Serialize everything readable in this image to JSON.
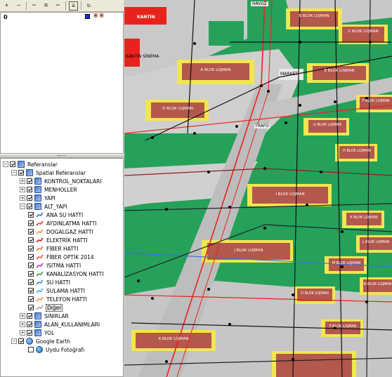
{
  "toolbar": {
    "icons": [
      "add-icon",
      "remove-icon",
      "expand-icon",
      "collapse-icon",
      "list-icon",
      "properties-icon",
      "refresh-icon"
    ]
  },
  "top_pane": {
    "value": "0",
    "colors": {
      "swatch": "#1c2fe8"
    }
  },
  "tree": {
    "root": "Referanslar",
    "spatial": "Spatial Referanslar",
    "kontrol": "KONTROL_NOKTALARI",
    "menholler": "MENHOLLER",
    "yapi": "YAPI",
    "alt_yapi": "ALT_YAPI",
    "layers": [
      {
        "label": "ANA SU HATTI",
        "color": "#3b6fe0"
      },
      {
        "label": "AYDINLATMA HATTI",
        "color": "#e03b3b"
      },
      {
        "label": "DOGALGAZ HATTI",
        "color": "#e0a03b"
      },
      {
        "label": "ELEKTRİK HATTI",
        "color": "#d02020"
      },
      {
        "label": "FİBER HATTI",
        "color": "#e07b3b"
      },
      {
        "label": "FİBER OPTİK 2014",
        "color": "#e05a3b"
      },
      {
        "label": "ISITMA HATTI",
        "color": "#b03bd0"
      },
      {
        "label": "KANALİZASYON HATTI",
        "color": "#5a8a3b"
      },
      {
        "label": "SU HATTI",
        "color": "#3b8ae0"
      },
      {
        "label": "SULAMA HATTI",
        "color": "#3bb0e0"
      },
      {
        "label": "TELEFON HATTI",
        "color": "#e09a3b"
      },
      {
        "label": "Diğer",
        "color": "#a0a0a0"
      }
    ],
    "sinirlar": "SINIRLAR",
    "alan": "ALAN_KULLANIMLARI",
    "yol": "YOL",
    "google": "Google Earth",
    "uydu": "Uydu Fotoğrafı"
  },
  "map": {
    "labels": {
      "kantin": "KANTİN",
      "havuz": "HAVUZ",
      "kantin_sinema": "KANTİN SİNEMA",
      "market": "MARKET",
      "trafo": "TRAFO",
      "blocks": [
        "A BLOK LOJMAN",
        "B BLOK LOJMAN",
        "C BLOK LOJMAN",
        "D BLOK LOJMAN",
        "E BLOK LOJMAN",
        "F BLOK LOJMAN",
        "G BLOK LOJMAN",
        "H BLOK LOJMAN",
        "I BLOK LOJMAN",
        "J BLOK LOJMAN",
        "K BLOK LOJMAN",
        "L BLOK LOJMAN",
        "M BLOK LOJMAN",
        "N BLOK LOJMAN",
        "O BLOK LOJMAN",
        "P BLOK LOJMAN",
        "R BLOK LOJMAN"
      ]
    },
    "colors": {
      "park": "#25a15a",
      "road": "#c8c8c8",
      "building": "#b4574c",
      "yard": "#f0e650",
      "red": "#e8231e"
    }
  }
}
